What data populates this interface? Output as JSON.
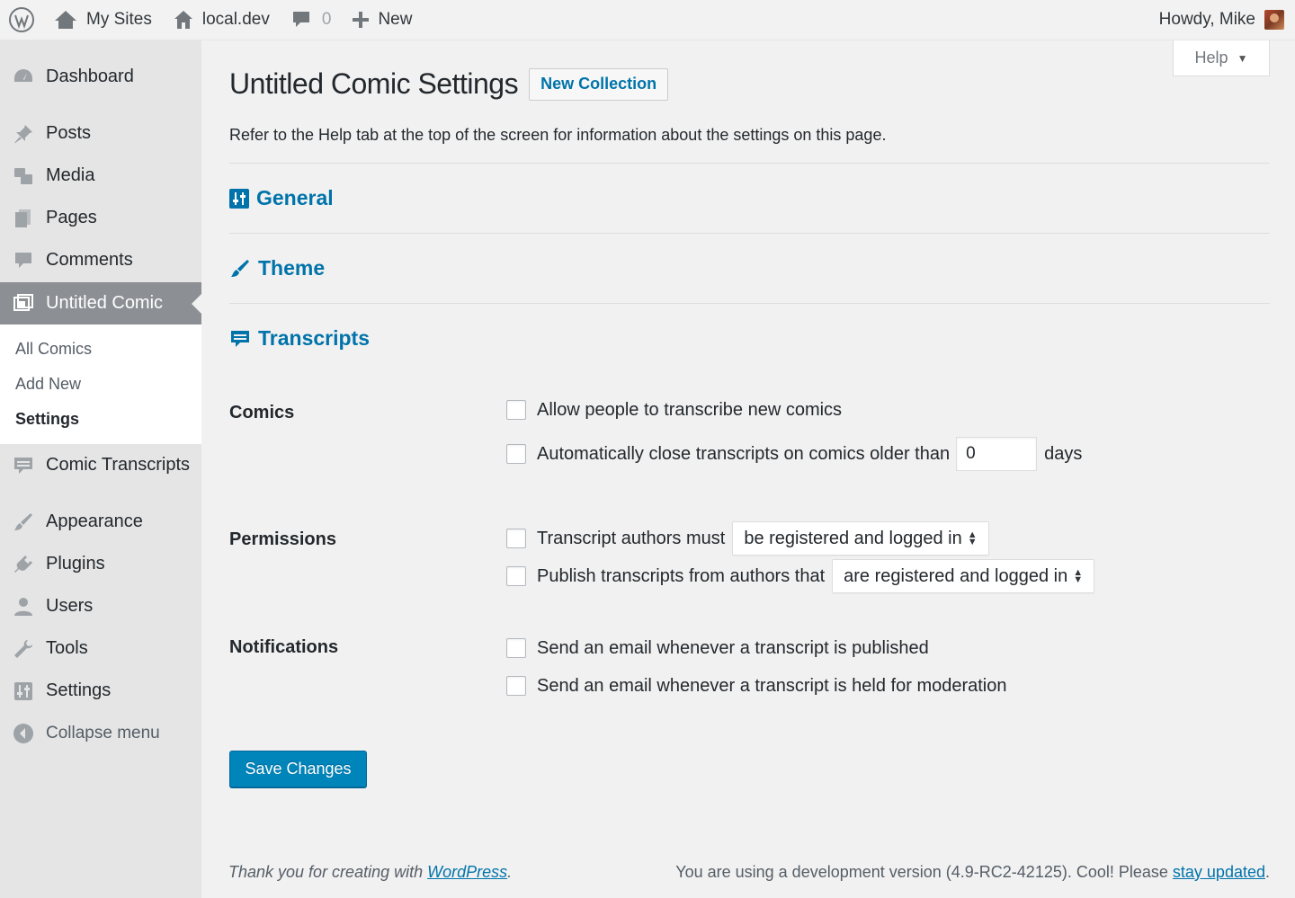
{
  "adminbar": {
    "my_sites": "My Sites",
    "site": "local.dev",
    "comments_count": "0",
    "new_label": "New",
    "howdy": "Howdy, Mike"
  },
  "sidebar": {
    "items": [
      {
        "label": "Dashboard",
        "icon": "dashboard-icon"
      },
      {
        "label": "Posts",
        "icon": "pin-icon"
      },
      {
        "label": "Media",
        "icon": "media-icon"
      },
      {
        "label": "Pages",
        "icon": "pages-icon"
      },
      {
        "label": "Comments",
        "icon": "comment-icon"
      },
      {
        "label": "Untitled Comic",
        "icon": "comic-icon"
      },
      {
        "label": "Comic Transcripts",
        "icon": "transcript-icon"
      },
      {
        "label": "Appearance",
        "icon": "brush-icon"
      },
      {
        "label": "Plugins",
        "icon": "plug-icon"
      },
      {
        "label": "Users",
        "icon": "user-icon"
      },
      {
        "label": "Tools",
        "icon": "wrench-icon"
      },
      {
        "label": "Settings",
        "icon": "sliders-icon"
      }
    ],
    "submenu": [
      "All Comics",
      "Add New",
      "Settings"
    ],
    "collapse": "Collapse menu"
  },
  "main": {
    "help": "Help",
    "title": "Untitled Comic Settings",
    "new_collection": "New Collection",
    "intro": "Refer to the Help tab at the top of the screen for information about the settings on this page.",
    "sections": [
      "General",
      "Theme",
      "Transcripts"
    ],
    "comics": {
      "label": "Comics",
      "opt1": "Allow people to transcribe new comics",
      "opt2": "Automatically close transcripts on comics older than",
      "days_value": "0",
      "days": "days"
    },
    "permissions": {
      "label": "Permissions",
      "opt1": "Transcript authors must",
      "select1": "be registered and logged in",
      "opt2": "Publish transcripts from authors that",
      "select2": "are registered and logged in"
    },
    "notifications": {
      "label": "Notifications",
      "opt1": "Send an email whenever a transcript is published",
      "opt2": "Send an email whenever a transcript is held for moderation"
    },
    "save": "Save Changes"
  },
  "footer": {
    "thanks_prefix": "Thank you for creating with ",
    "wordpress": "WordPress",
    "thanks_suffix": ".",
    "version": "You are using a development version (4.9-RC2-42125). Cool! Please ",
    "stay_updated": "stay updated",
    "version_suffix": "."
  }
}
